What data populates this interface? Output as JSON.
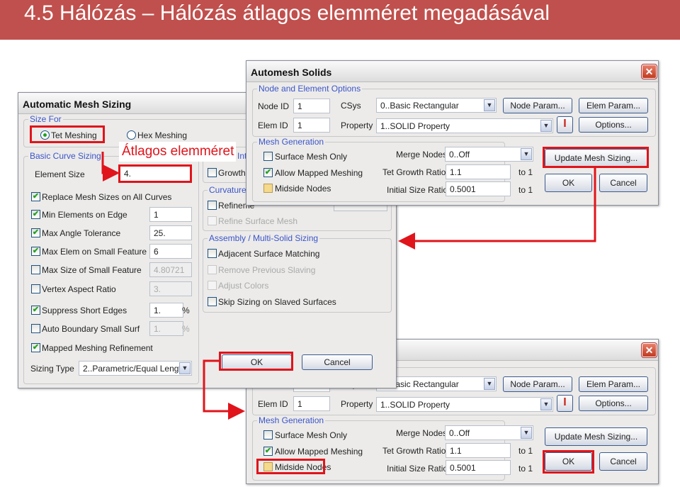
{
  "slide": {
    "title": "4.5 Hálózás – Hálózás átlagos elemméret megadásával",
    "annotation": "Átlagos elemméret",
    "highlight_color": "#e0141b"
  },
  "sizing": {
    "title": "Automatic Mesh Sizing",
    "size_for": {
      "label": "Size For",
      "tet": "Tet Meshing",
      "hex": "Hex Meshing",
      "selected": "Tet Meshing"
    },
    "basic": {
      "label": "Basic Curve Sizing",
      "element_size_label": "Element Size",
      "element_size": "4.",
      "rows": [
        {
          "label": "Replace Mesh Sizes on All Curves",
          "checked": true
        },
        {
          "label": "Min Elements on Edge",
          "checked": true,
          "value": "1"
        },
        {
          "label": "Max Angle Tolerance",
          "checked": true,
          "value": "25."
        },
        {
          "label": "Max Elem on Small Feature",
          "checked": true,
          "value": "6"
        },
        {
          "label": "Max Size of Small Feature",
          "checked": false,
          "value": "4.80721",
          "disabled": true
        },
        {
          "label": "Vertex Aspect Ratio",
          "checked": false,
          "value": "3.",
          "disabled": true
        },
        {
          "label": "Suppress Short Edges",
          "checked": true,
          "value": "1.",
          "unit": "%"
        },
        {
          "label": "Auto Boundary Small Surf",
          "checked": false,
          "value": "1.",
          "unit": "%",
          "disabled": true
        },
        {
          "label": "Mapped Meshing Refinement",
          "checked": true
        }
      ],
      "sizing_type_label": "Sizing Type",
      "sizing_type": "2..Parametric/Equal Length"
    },
    "interior": {
      "label": "Int",
      "growth": "Growth"
    },
    "curvature": {
      "label": "Curvature-",
      "refinement": "Refineme",
      "refine_surface": "Refine Surface Mesh"
    },
    "assembly": {
      "label": "Assembly / Multi-Solid Sizing",
      "items": [
        {
          "label": "Adjacent Surface Matching",
          "disabled": false
        },
        {
          "label": "Remove Previous Slaving",
          "disabled": true
        },
        {
          "label": "Adjust Colors",
          "disabled": true
        },
        {
          "label": "Skip Sizing on Slaved Surfaces",
          "disabled": false
        }
      ]
    },
    "ok": "OK",
    "cancel": "Cancel"
  },
  "automesh": {
    "title": "Automesh Solids",
    "node_elem": {
      "label": "Node and Element Options",
      "node_id_label": "Node ID",
      "node_id": "1",
      "elem_id_label": "Elem ID",
      "elem_id": "1",
      "csys_label": "CSys",
      "csys": "0..Basic Rectangular",
      "property_label": "Property",
      "property": "1..SOLID Property",
      "node_param": "Node Param...",
      "elem_param": "Elem Param...",
      "options": "Options..."
    },
    "mesh_gen": {
      "label": "Mesh Generation",
      "surface_only": "Surface Mesh Only",
      "allow_mapped": "Allow Mapped Meshing",
      "midside": "Midside Nodes",
      "merge_label": "Merge Nodes",
      "merge": "0..Off",
      "tet_growth_label": "Tet Growth Ratio",
      "tet_growth": "1.1",
      "initial_label": "Initial Size Ratio",
      "initial": "0.5001",
      "to1": "to 1"
    },
    "update": "Update Mesh Sizing...",
    "ok": "OK",
    "cancel": "Cancel",
    "close": "✕"
  }
}
